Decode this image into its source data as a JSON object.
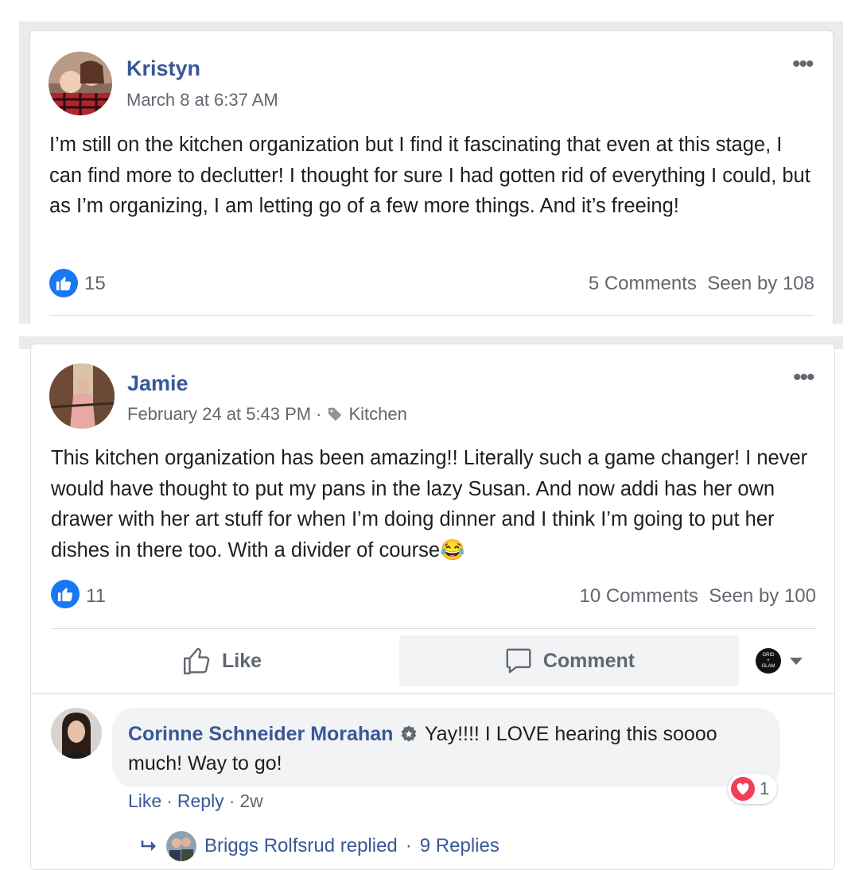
{
  "posts": [
    {
      "author": "Kristyn",
      "timestamp": "March 8 at 6:37 AM",
      "more": "•••",
      "text": "I’m still on the kitchen organization but I find it fascinating that even at this stage, I can find more to declutter! I thought for sure I had gotten rid of everything I could, but as I’m organizing, I am letting go of a few more things. And it’s freeing!",
      "likes": "15",
      "comments": "5 Comments",
      "seen": "Seen by 108"
    },
    {
      "author": "Jamie",
      "timestamp": "February 24 at 5:43 PM",
      "meta_sep": "·",
      "tag": "Kitchen",
      "more": "•••",
      "text": "This kitchen organization has been amazing!! Literally such a game changer! I never would have thought to put my pans in the lazy Susan. And now addi has her own drawer with her art stuff for when I’m doing dinner and I think I’m going to put her dishes in there too. With a divider of course",
      "emoji": "😂",
      "likes": "11",
      "comments": "10 Comments",
      "seen": "Seen by 100",
      "actions": {
        "like": "Like",
        "comment": "Comment",
        "page_logo_text": "GRID + GLAM"
      }
    }
  ],
  "comment": {
    "author": "Corinne Schneider Morahan",
    "text": "Yay!!!! I LOVE hearing this soooo much! Way to go!",
    "like": "Like",
    "sep1": "·",
    "reply": "Reply",
    "sep2": "·",
    "age": "2w",
    "reaction_count": "1",
    "replies_author": "Briggs Rolfsrud replied",
    "replies_sep": "·",
    "replies_count": "9 Replies"
  },
  "colors": {
    "link": "#385898",
    "like_blue": "#1877f2",
    "love_red": "#f33e58",
    "meta_gray": "#616770",
    "band_gray": "#e9ebee"
  },
  "icons": [
    "more-icon",
    "like-badge-icon",
    "tag-icon",
    "thumbs-up-icon",
    "comment-icon",
    "caret-down-icon",
    "love-icon",
    "reply-arrow-icon",
    "verified-badge-icon"
  ]
}
